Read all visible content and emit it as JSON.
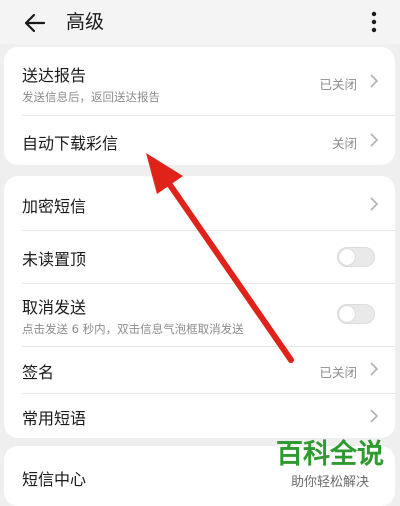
{
  "header": {
    "title": "高级",
    "back_icon": "arrow-left-icon",
    "more_icon": "more-vertical-icon"
  },
  "groups": [
    {
      "items": [
        {
          "label": "送达报告",
          "sublabel": "发送信息后，返回送达报告",
          "value": "已关闭",
          "control": "chevron"
        },
        {
          "label": "自动下载彩信",
          "value": "关闭",
          "control": "chevron"
        }
      ]
    },
    {
      "items": [
        {
          "label": "加密短信",
          "control": "chevron"
        },
        {
          "label": "未读置顶",
          "control": "toggle",
          "toggle_on": false
        },
        {
          "label": "取消发送",
          "sublabel": "点击发送 6 秒内，双击信息气泡框取消发送",
          "control": "toggle",
          "toggle_on": false
        },
        {
          "label": "签名",
          "value": "已关闭",
          "control": "chevron"
        },
        {
          "label": "常用短语",
          "control": "chevron"
        }
      ]
    },
    {
      "items": [
        {
          "label": "短信中心"
        }
      ]
    }
  ],
  "annotation": {
    "type": "red-arrow",
    "color": "#e0231a",
    "points_to": "自动下载彩信"
  },
  "watermark": {
    "title": "百科全说",
    "subtitle": "助你轻松解决",
    "color": "#2f9a2f"
  }
}
